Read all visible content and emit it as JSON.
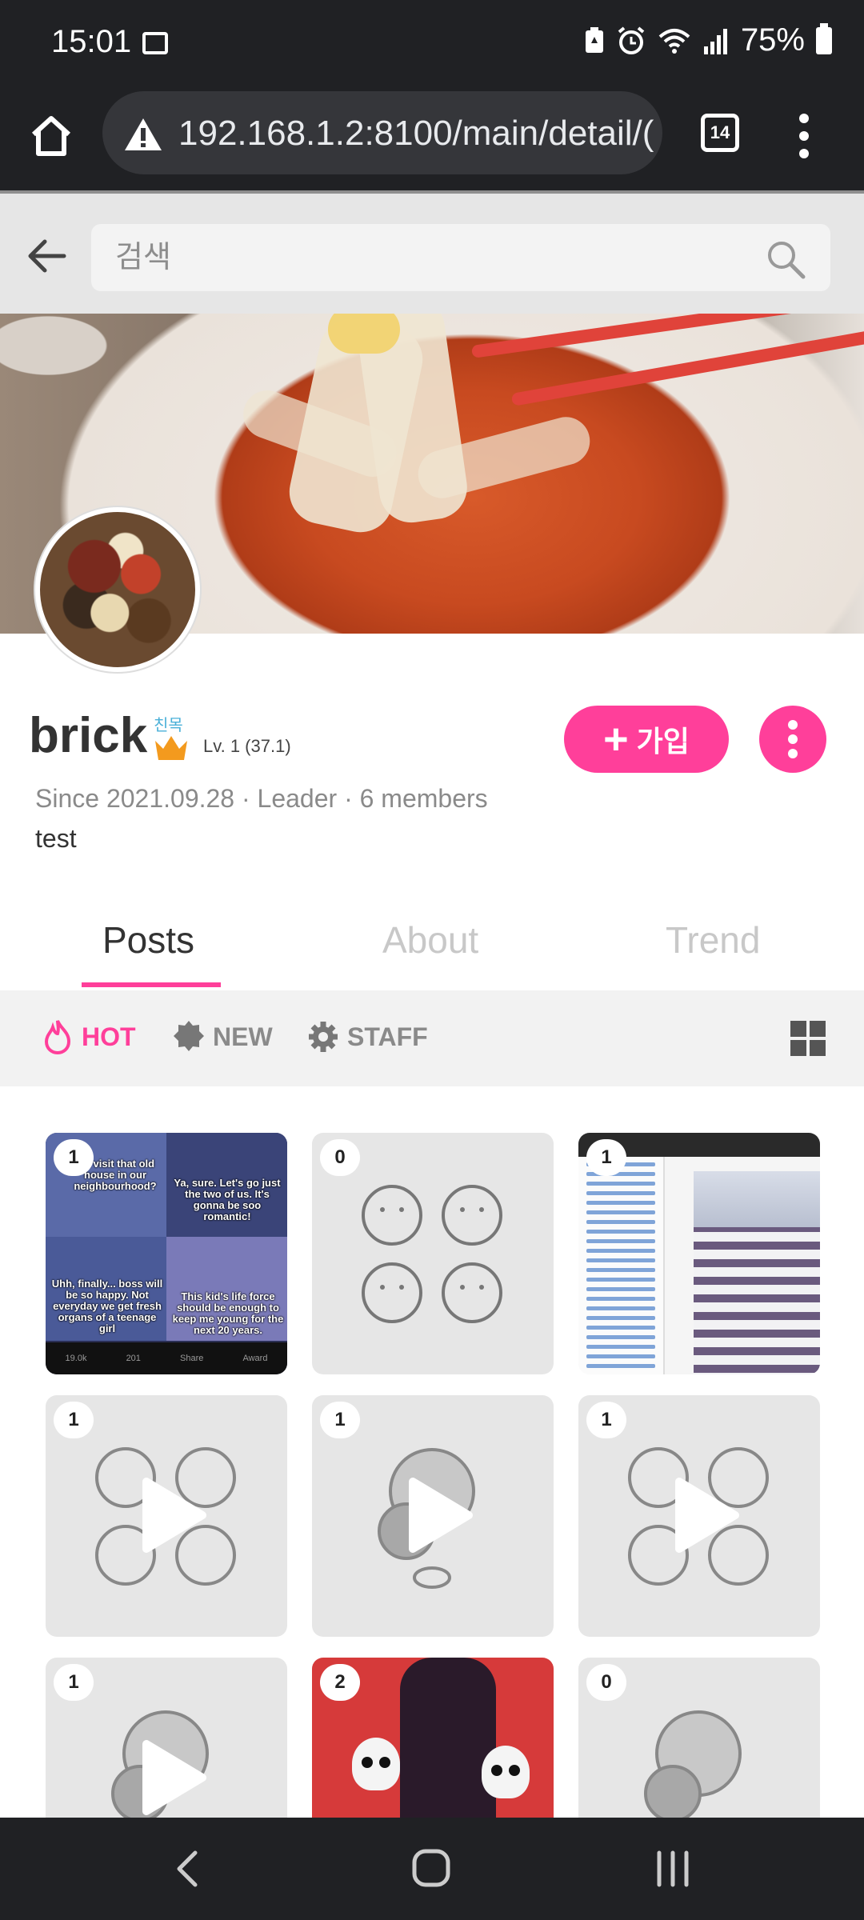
{
  "status_bar": {
    "time": "15:01",
    "battery": "75%"
  },
  "browser": {
    "url": "192.168.1.2:8100/main/detail/(",
    "tab_count": "14"
  },
  "search": {
    "placeholder": "검색"
  },
  "profile": {
    "name": "brick",
    "level_tag": "친목",
    "level": "Lv. 1 (37.1)",
    "join_label": "가입",
    "meta": "Since 2021.09.28 · Leader · 6 members",
    "description": "test"
  },
  "tabs": [
    {
      "label": "Posts",
      "active": true
    },
    {
      "label": "About",
      "active": false
    },
    {
      "label": "Trend",
      "active": false
    }
  ],
  "filters": [
    {
      "label": "HOT",
      "icon": "flame-icon",
      "active": true
    },
    {
      "label": "NEW",
      "icon": "badge-icon",
      "active": false
    },
    {
      "label": "STAFF",
      "icon": "gear-icon",
      "active": false
    }
  ],
  "posts": [
    {
      "count": "1",
      "kind": "meme"
    },
    {
      "count": "0",
      "kind": "placeholder-four"
    },
    {
      "count": "1",
      "kind": "screenshot"
    },
    {
      "count": "1",
      "kind": "video-four"
    },
    {
      "count": "1",
      "kind": "video-single"
    },
    {
      "count": "1",
      "kind": "video-four"
    },
    {
      "count": "1",
      "kind": "video-single"
    },
    {
      "count": "2",
      "kind": "cartoon"
    },
    {
      "count": "0",
      "kind": "placeholder-single"
    }
  ],
  "meme": {
    "caption_tl": "...a visit that old house in our neighbourhood?",
    "caption_tr": "Ya, sure. Let's go just the two of us. It's gonna be soo romantic!",
    "caption_bl": "Uhh, finally... boss will be so happy. Not everyday we get fresh organs of a teenage girl",
    "caption_br": "This kid's life force should be enough to keep me young for the next 20 years.",
    "footer_votes": "19.0k",
    "footer_comments": "201",
    "footer_share": "Share",
    "footer_award": "Award"
  },
  "colors": {
    "accent": "#ff3f9a",
    "header_bg": "#202124"
  }
}
